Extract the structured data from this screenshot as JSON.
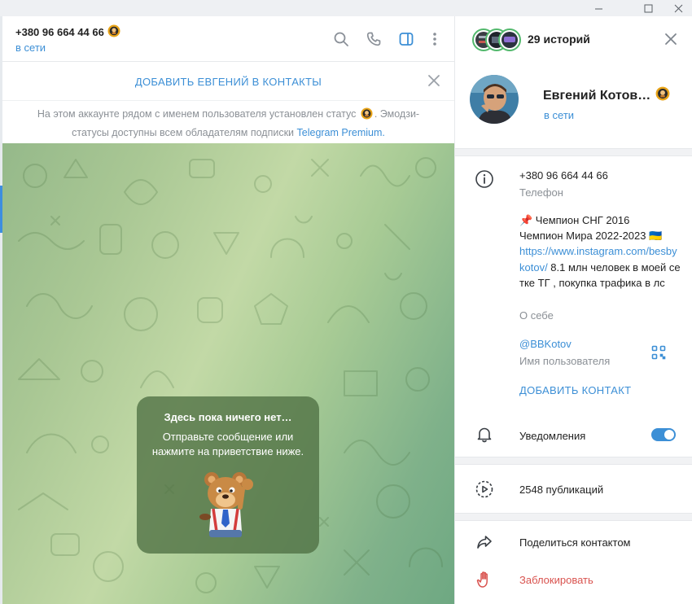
{
  "window": {
    "minimize_icon": "minimize-icon",
    "maximize_icon": "maximize-icon",
    "close_icon": "close-icon"
  },
  "chat": {
    "phone": "+380 96 664 44 66",
    "status": "в сети",
    "icons": [
      "search-icon",
      "phone-icon",
      "sidebar-toggle-icon",
      "more-icon"
    ],
    "add_contact_banner": "ДОБАВИТЬ ЕВГЕНИЙ В КОНТАКТЫ",
    "notice_part1": "На этом аккаунте рядом с именем пользователя установлен статус",
    "notice_part2": ". Эмодзи-статусы доступны всем обладателям подписки",
    "notice_link": "Telegram Premium.",
    "empty_title": "Здесь пока ничего нет…",
    "empty_text": "Отправьте сообщение или нажмите на приветствие ниже."
  },
  "profile": {
    "stories_label": "29 историй",
    "name": "Евгений Котов…",
    "status": "в сети",
    "phone": "+380 96 664 44 66",
    "phone_label": "Телефон",
    "bio_line1": "📌 Чемпион СНГ 2016",
    "bio_line2": "Чемпион Мира 2022-2023 🇺🇦",
    "bio_link": "https://www.instagram.com/besbykotov/",
    "bio_rest": " 8.1 млн человек в моей сетке ТГ , покупка трафика в лс",
    "bio_label": "О себе",
    "username": "@BBKotov",
    "username_label": "Имя пользователя",
    "add_contact": "ДОБАВИТЬ КОНТАКТ",
    "notifications_label": "Уведомления",
    "notifications_on": true,
    "publications": "2548 публикаций",
    "share_contact": "Поделиться контактом",
    "block": "Заблокировать"
  },
  "colors": {
    "accent": "#3c8fd6",
    "danger": "#d9534f",
    "chat_bg": "#a9c794"
  }
}
